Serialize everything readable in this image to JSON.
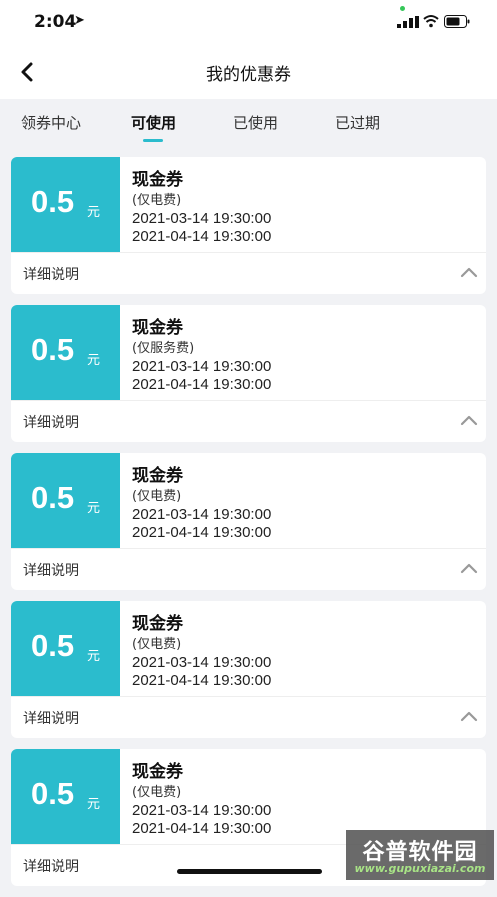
{
  "status_bar": {
    "time": "2:04"
  },
  "header": {
    "title": "我的优惠券"
  },
  "tabs": [
    {
      "label": "领券中心"
    },
    {
      "label": "可使用"
    },
    {
      "label": "已使用"
    },
    {
      "label": "已过期"
    }
  ],
  "coupons": [
    {
      "amount": "0.5",
      "unit": "元",
      "title": "现金券",
      "scope": "(仅电费)",
      "start": "2021-03-14 19:30:00",
      "end": "2021-04-14 19:30:00",
      "detail_label": "详细说明"
    },
    {
      "amount": "0.5",
      "unit": "元",
      "title": "现金券",
      "scope": "(仅服务费)",
      "start": "2021-03-14 19:30:00",
      "end": "2021-04-14 19:30:00",
      "detail_label": "详细说明"
    },
    {
      "amount": "0.5",
      "unit": "元",
      "title": "现金券",
      "scope": "(仅电费)",
      "start": "2021-03-14 19:30:00",
      "end": "2021-04-14 19:30:00",
      "detail_label": "详细说明"
    },
    {
      "amount": "0.5",
      "unit": "元",
      "title": "现金券",
      "scope": "(仅电费)",
      "start": "2021-03-14 19:30:00",
      "end": "2021-04-14 19:30:00",
      "detail_label": "详细说明"
    },
    {
      "amount": "0.5",
      "unit": "元",
      "title": "现金券",
      "scope": "(仅电费)",
      "start": "2021-03-14 19:30:00",
      "end": "2021-04-14 19:30:00",
      "detail_label": "详细说明"
    }
  ],
  "watermark": {
    "title": "谷普软件园",
    "url": "www.gupuxiazai.com"
  },
  "icons": {
    "back": "chevron-left-icon",
    "expand": "chevron-up-icon",
    "location": "location-arrow-icon",
    "signal": "cellular-signal-icon",
    "wifi": "wifi-icon",
    "battery": "battery-icon"
  },
  "colors": {
    "accent": "#2bbccd",
    "background": "#f1f2f5"
  }
}
